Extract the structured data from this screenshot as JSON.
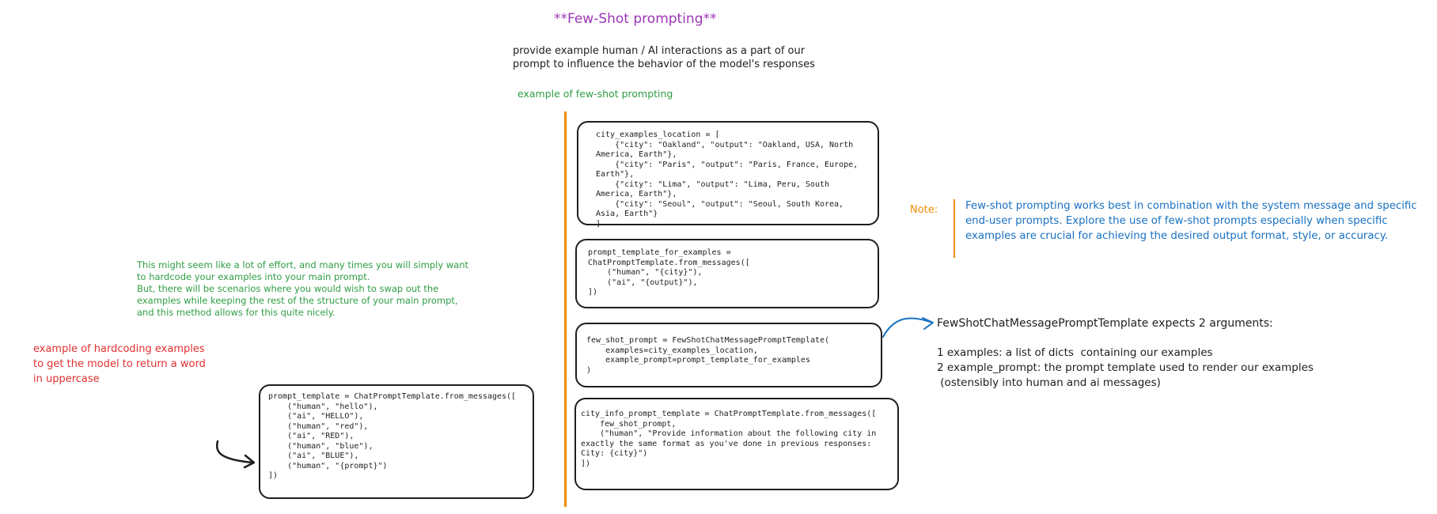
{
  "title": "**Few-Shot prompting**",
  "subtitle": "provide example human / AI interactions as a part of our\n prompt to influence the behavior of the model's responses",
  "example_label": "example of few-shot prompting",
  "green_note": "This might seem like a lot of effort, and many times you will simply want to hardcode your examples into your main prompt.\n But, there will be scenarios where you would wish to swap out the examples while keeping the rest of the structure of your main prompt, and this method allows for this quite nicely.",
  "red_note": "example of hardcoding examples\nto get the model to return a word\n in uppercase",
  "note": {
    "label": "Note:",
    "text": "Few-shot prompting works best in combination with the system message and specific end-user prompts. Explore the use of few-shot prompts especially when specific examples are crucial for achieving the desired output format, style, or accuracy."
  },
  "fewshot_explain": {
    "heading": "FewShotChatMessagePromptTemplate expects 2 arguments:",
    "items": [
      "1 examples: a list of dicts  containing our examples",
      "2 example_prompt: the prompt template used to render our examples",
      " (ostensibly into human and ai messages)"
    ]
  },
  "code": {
    "hardcoded": "prompt_template = ChatPromptTemplate.from_messages([\n    (\"human\", \"hello\"),\n    (\"ai\", \"HELLO\"),\n    (\"human\", \"red\"),\n    (\"ai\", \"RED\"),\n    (\"human\", \"blue\"),\n    (\"ai\", \"BLUE\"),\n    (\"human\", \"{prompt}\")\n])",
    "city_examples": "city_examples_location = [\n    {\"city\": \"Oakland\", \"output\": \"Oakland, USA, North America, Earth\"},\n    {\"city\": \"Paris\", \"output\": \"Paris, France, Europe, Earth\"},\n    {\"city\": \"Lima\", \"output\": \"Lima, Peru, South America, Earth\"},\n    {\"city\": \"Seoul\", \"output\": \"Seoul, South Korea, Asia, Earth\"}\n]",
    "prompt_template_for_examples": "prompt_template_for_examples =\nChatPromptTemplate.from_messages([\n    (\"human\", \"{city}\"),\n    (\"ai\", \"{output}\"),\n])",
    "few_shot_prompt": "few_shot_prompt = FewShotChatMessagePromptTemplate(\n    examples=city_examples_location,\n    example_prompt=prompt_template_for_examples\n)",
    "city_info": "city_info_prompt_template = ChatPromptTemplate.from_messages([\n    few_shot_prompt,\n    (\"human\", \"Provide information about the following city in exactly the same format as you've done in previous responses: City: {city}\")\n])"
  },
  "colors": {
    "title": "#9c36b5",
    "green": "#2f9e44",
    "red": "#e03131",
    "orange": "#f08c00",
    "blue": "#1971c2",
    "ink": "#1e1e1e"
  }
}
